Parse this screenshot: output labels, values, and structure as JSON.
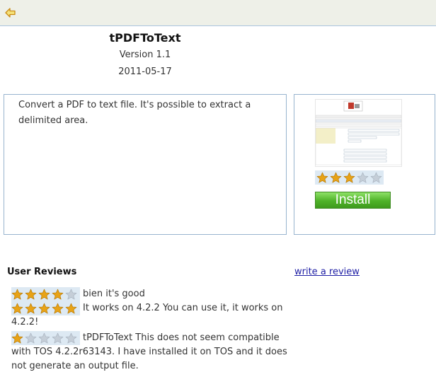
{
  "toolbar": {
    "back_icon": "back-arrow-icon"
  },
  "component": {
    "title": "tPDFToText",
    "version": "Version 1.1",
    "date": "2011-05-17",
    "description": "Convert a PDF to text file. It's possible to extract a delimited area.",
    "rating": 3,
    "install_label": "Install"
  },
  "reviews_section": {
    "heading": "User Reviews",
    "write_review_label": "write a review",
    "reviews": [
      {
        "rating": 4,
        "text": "bien it's good"
      },
      {
        "rating": 5,
        "text": "It works on 4.2.2 You can use it, it works on 4.2.2!"
      },
      {
        "rating": 1,
        "text": "tPDFToText This does not seem compatible with TOS 4.2.2r63143. I have installed it on TOS and it does not generate an output file."
      }
    ]
  },
  "colors": {
    "star_filled": "#e8a317",
    "star_empty": "#c5ced8",
    "link": "#1f1fa5",
    "border": "#98b4cf",
    "install_green": "#4fb228"
  }
}
